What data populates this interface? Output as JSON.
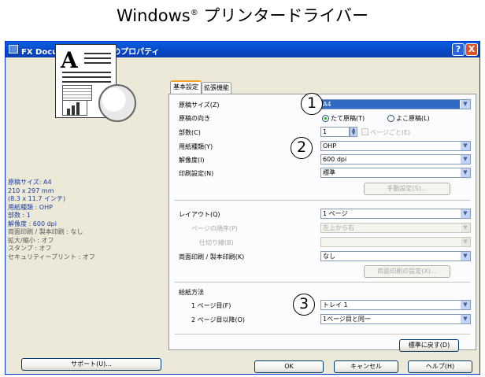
{
  "page_heading": {
    "text": "Windows",
    "sup": "®",
    "rest": " プリンタードライバー"
  },
  "window": {
    "title": "FX DocuPrint P300 dのプロパティ",
    "help_btn": "?",
    "close_btn": "X"
  },
  "info": {
    "lines": [
      {
        "text": "原稿サイズ: A4",
        "color": "blue"
      },
      {
        "text": "210 x 297 mm",
        "color": "blue"
      },
      {
        "text": "(8.3 x 11.7 インチ)",
        "color": "blue"
      },
      {
        "text": "用紙種類 : OHP",
        "color": "blue"
      },
      {
        "text": "部数 : 1",
        "color": "blue"
      },
      {
        "text": "解像度 : 600 dpi",
        "color": "blue"
      },
      {
        "text": "両面印刷 / 製本印刷 : なし",
        "color": "gray"
      },
      {
        "text": "拡大/縮小 : オフ",
        "color": "gray"
      },
      {
        "text": "スタンプ : オフ",
        "color": "gray"
      },
      {
        "text": "セキュリティープリント : オフ",
        "color": "gray"
      }
    ]
  },
  "support_button": "サポート(U)...",
  "tabs": [
    {
      "label": "基本設定",
      "active": true
    },
    {
      "label": "拡張機能",
      "active": false
    }
  ],
  "fields": {
    "paper_size": {
      "label": "原稿サイズ(Z)",
      "value": "A4"
    },
    "orientation": {
      "label": "原稿の向き",
      "portrait": "たて原稿(T)",
      "landscape": "よこ原稿(L)",
      "selected": "portrait"
    },
    "copies": {
      "label": "部数(C)",
      "value": "1",
      "collate": "ページごと(E)"
    },
    "media_type": {
      "label": "用紙種類(Y)",
      "value": "OHP"
    },
    "resolution": {
      "label": "解像度(I)",
      "value": "600 dpi"
    },
    "print_setting": {
      "label": "印刷設定(N)",
      "value": "標準"
    },
    "manual_setting_btn": "手動設定(S)...",
    "layout": {
      "label": "レイアウト(Q)",
      "value": "1 ページ"
    },
    "page_order": {
      "label": "ページの順序(P)",
      "value": "左上から右"
    },
    "border": {
      "label": "仕切り線(B)",
      "value": ""
    },
    "duplex": {
      "label": "両面印刷 / 製本印刷(K)",
      "value": "なし"
    },
    "duplex_btn": "両面印刷の設定(X)...",
    "paper_source_title": "給紙方法",
    "first_page": {
      "label": "1 ページ目(F)",
      "value": "トレイ 1"
    },
    "other_pages": {
      "label": "2 ページ目以降(O)",
      "value": "1ページ目と同一"
    },
    "default_btn": "標準に戻す(D)"
  },
  "callouts": [
    "1",
    "2",
    "3"
  ],
  "footer": {
    "ok": "OK",
    "cancel": "キャンセル",
    "help": "ヘルプ(H)"
  },
  "colors": {
    "title_bar": "#0846c4",
    "selected_combo": "#316ac5",
    "dialog_bg": "#ece9d8"
  }
}
